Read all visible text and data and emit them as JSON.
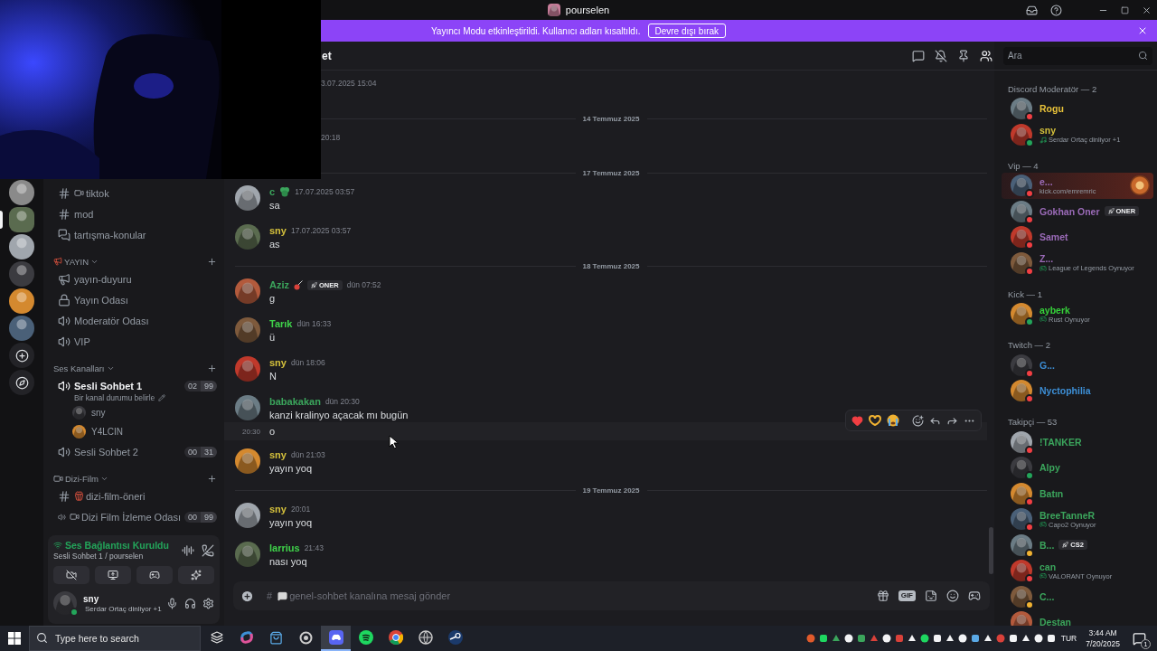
{
  "title_bar": {
    "title": "pourselen"
  },
  "banner": {
    "text": "Yayıncı Modu etkinleştirildi. Kullanıcı adları kısaltıldı.",
    "button": "Devre dışı bırak"
  },
  "servers": [
    {
      "kind": "server",
      "selected": false
    },
    {
      "kind": "server",
      "selected": true
    },
    {
      "kind": "server",
      "selected": false
    },
    {
      "kind": "server",
      "selected": false
    },
    {
      "kind": "server",
      "selected": false
    },
    {
      "kind": "server",
      "selected": false
    },
    {
      "kind": "add",
      "selected": false
    },
    {
      "kind": "discover",
      "selected": false
    }
  ],
  "channels": [
    {
      "kind": "text",
      "name": "tiktok",
      "active": false
    },
    {
      "kind": "text",
      "name": "mod",
      "active": false
    },
    {
      "kind": "forum",
      "name": "tartışma-konular",
      "active": false
    },
    {
      "kind": "category",
      "name": "YAYIN"
    },
    {
      "kind": "announcement",
      "name": "yayın-duyuru",
      "active": false
    },
    {
      "kind": "locked",
      "name": "Yayın Odası",
      "active": false
    },
    {
      "kind": "voice",
      "name": "Moderatör Odası",
      "active": false
    },
    {
      "kind": "voice",
      "name": "VIP",
      "active": false
    },
    {
      "kind": "category",
      "name": "Ses Kanalları"
    },
    {
      "kind": "voice",
      "name": "Sesli Sohbet 1",
      "active": true,
      "counts": [
        "02",
        "99"
      ],
      "status": "Bir kanal durumu belirle",
      "members": [
        "sny",
        "Y4LCIN"
      ]
    },
    {
      "kind": "voice",
      "name": "Sesli Sohbet 2",
      "active": false,
      "counts": [
        "00",
        "31"
      ]
    },
    {
      "kind": "category",
      "name": "Dizi-Film"
    },
    {
      "kind": "text",
      "name": "dizi-film-öneri",
      "active": false
    },
    {
      "kind": "voice",
      "name": "Dizi Film İzleme Odası",
      "active": false,
      "counts": [
        "00",
        "99"
      ]
    }
  ],
  "voice_panel": {
    "status": "Ses Bağlantısı Kuruldu",
    "channel": "Sesli Sohbet 1 / pourselen"
  },
  "user_panel": {
    "name": "sny",
    "activity": "Serdar Ortaç dinliyor +1",
    "status": {
      "color": "#23a55a"
    }
  },
  "chat": {
    "header": "et",
    "messages": [
      {
        "kind": "covered",
        "time": "3.07.2025 15:04"
      },
      {
        "kind": "divider",
        "label": "14 Temmuz 2025"
      },
      {
        "kind": "covered",
        "time": "20:18"
      },
      {
        "kind": "divider",
        "label": "17 Temmuz 2025"
      },
      {
        "kind": "message",
        "author": "c",
        "color": "#3ba55c",
        "emoji": {
          "kind": "clover"
        },
        "time": "17.07.2025 03:57",
        "text": "sa"
      },
      {
        "kind": "message",
        "author": "sny",
        "color": "#d4c03c",
        "time": "17.07.2025 03:57",
        "text": "as"
      },
      {
        "kind": "divider",
        "label": "18 Temmuz 2025"
      },
      {
        "kind": "message",
        "author": "Aziz",
        "color": "#3ba55c",
        "emoji": {
          "kind": "guitar"
        },
        "tag": "ONER",
        "time": "dün 07:52",
        "text": "g"
      },
      {
        "kind": "message",
        "author": "Tarık",
        "color": "#3fd34a",
        "time": "dün 16:33",
        "text": "ü"
      },
      {
        "kind": "message",
        "author": "sny",
        "color": "#d4c03c",
        "time": "dün 18:06",
        "text": "N"
      },
      {
        "kind": "message",
        "author": "babakakan",
        "color": "#3ba55c",
        "time": "dün 20:30",
        "text": "kanzi kralinyo açacak mı bugün"
      },
      {
        "kind": "continuation",
        "time": "20:30",
        "text": "o",
        "hovered": true
      },
      {
        "kind": "message",
        "author": "sny",
        "color": "#d4c03c",
        "time": "dün 21:03",
        "text": "yayın yoq"
      },
      {
        "kind": "divider",
        "label": "19 Temmuz 2025"
      },
      {
        "kind": "message",
        "author": "sny",
        "color": "#d4c03c",
        "time": "20:01",
        "text": "yayın yoq"
      },
      {
        "kind": "message",
        "author": "larrius",
        "color": "#3fd34a",
        "time": "21:43",
        "text": "nası yoq"
      }
    ],
    "composer": {
      "prefix": "#",
      "placeholder": "genel-sohbet kanalına mesaj gönder",
      "gif_label": "GIF"
    }
  },
  "members": {
    "search": {
      "placeholder": "Ara"
    },
    "sections": [
      {
        "title": "Discord Moderatör — 2",
        "members": [
          {
            "name": "Rogu",
            "color": "#e8c23a",
            "status": {
              "color": "#f23f43"
            },
            "nameplate": false
          },
          {
            "name": "sny",
            "color": "#d4c03c",
            "status": {
              "color": "#23a55a"
            },
            "activity": {
              "kind": "listening",
              "text": "Serdar Ortaç dinliyor +1"
            },
            "nameplate": false
          }
        ]
      },
      {
        "title": "Vip — 4",
        "members": [
          {
            "name": "e...",
            "color": "#9b6bb8",
            "status": {
              "color": "#f23f43"
            },
            "activity": {
              "kind": "link",
              "text": "kick.com/emremric"
            },
            "nameplate": true
          },
          {
            "name": "Gokhan Oner",
            "color": "#9b6bb8",
            "status": {
              "color": "#f23f43"
            },
            "tag": "ONER",
            "nameplate": false
          },
          {
            "name": "Samet",
            "color": "#9b6bb8",
            "status": {
              "color": "#f23f43"
            },
            "nameplate": false
          },
          {
            "name": "Z...",
            "color": "#9b6bb8",
            "status": {
              "color": "#f23f43"
            },
            "activity": {
              "kind": "playing",
              "text": "League of Legends Oynuyor"
            },
            "nameplate": false
          }
        ]
      },
      {
        "title": "Kick — 1",
        "members": [
          {
            "name": "ayberk",
            "color": "#36d13a",
            "status": {
              "color": "#23a55a"
            },
            "activity": {
              "kind": "playing",
              "text": "Rust Oynuyor"
            },
            "nameplate": false
          }
        ]
      },
      {
        "title": "Twitch — 2",
        "members": [
          {
            "name": "G...",
            "color": "#3d8fd6",
            "status": {
              "color": "#f23f43"
            },
            "nameplate": false
          },
          {
            "name": "Nyctophilia",
            "color": "#3d8fd6",
            "status": {
              "color": "#f23f43"
            },
            "nameplate": false
          }
        ]
      },
      {
        "title": "Takipçi — 53",
        "members": [
          {
            "name": "!TANKER",
            "color": "#3ba55c",
            "status": {
              "color": "#f23f43"
            },
            "nameplate": false
          },
          {
            "name": "Alpy",
            "color": "#3ba55c",
            "status": {
              "color": "#23a55a"
            },
            "nameplate": false
          },
          {
            "name": "Batın",
            "color": "#3ba55c",
            "status": {
              "color": "#f23f43"
            },
            "nameplate": false
          },
          {
            "name": "BreeTanneR",
            "color": "#3ba55c",
            "status": {
              "color": "#f23f43"
            },
            "activity": {
              "kind": "playing",
              "text": "Capo2 Oynuyor"
            },
            "nameplate": false
          },
          {
            "name": "B...",
            "color": "#3ba55c",
            "status": {
              "color": "#f0b232"
            },
            "tag": "CS2",
            "nameplate": false
          },
          {
            "name": "can",
            "color": "#3ba55c",
            "status": {
              "color": "#f23f43"
            },
            "activity": {
              "kind": "playing",
              "text": "VALORANT Oynuyor"
            },
            "nameplate": false
          },
          {
            "name": "C...",
            "color": "#3ba55c",
            "status": {
              "color": "#f0b232"
            },
            "nameplate": false
          },
          {
            "name": "Destan",
            "color": "#3ba55c",
            "nameplate": false
          }
        ]
      }
    ]
  },
  "taskbar": {
    "search_placeholder": "Type here to search",
    "apps": [
      {
        "kind": "taskview",
        "active": false
      },
      {
        "kind": "swirl",
        "active": false
      },
      {
        "kind": "bag",
        "active": false
      },
      {
        "kind": "ring",
        "active": false
      },
      {
        "kind": "gamepad",
        "active": true
      },
      {
        "kind": "waves",
        "active": false
      },
      {
        "kind": "wheel",
        "active": false
      },
      {
        "kind": "globe",
        "active": false
      },
      {
        "kind": "steam",
        "active": false
      }
    ],
    "language": "TUR",
    "time": "3:44 AM",
    "date": "7/20/2025",
    "notifications": "1"
  }
}
